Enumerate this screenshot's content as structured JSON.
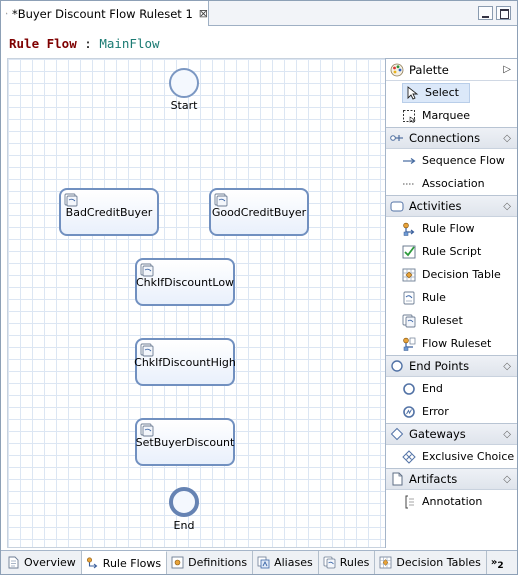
{
  "editor": {
    "tab_title": "*Buyer Discount Flow Ruleset 1",
    "close_glyph": "⊠"
  },
  "flow": {
    "keyword": "Rule Flow",
    "separator": ":",
    "name": "MainFlow"
  },
  "canvas": {
    "start_label": "Start",
    "end_label": "End",
    "nodes": {
      "bad_credit": "BadCreditBuyer",
      "good_credit": "GoodCreditBuyer",
      "chk_low": "ChkIfDiscountLow",
      "chk_high": "ChkIfDiscountHigh",
      "set_discount": "SetBuyerDiscount"
    }
  },
  "palette": {
    "title": "Palette",
    "tools": {
      "select": "Select",
      "marquee": "Marquee"
    },
    "connections": {
      "title": "Connections",
      "sequence_flow": "Sequence Flow",
      "association": "Association"
    },
    "activities": {
      "title": "Activities",
      "rule_flow": "Rule Flow",
      "rule_script": "Rule Script",
      "decision_table": "Decision Table",
      "rule": "Rule",
      "ruleset": "Ruleset",
      "flow_ruleset": "Flow Ruleset"
    },
    "end_points": {
      "title": "End Points",
      "end": "End",
      "error": "Error"
    },
    "gateways": {
      "title": "Gateways",
      "exclusive_choice": "Exclusive Choice"
    },
    "artifacts": {
      "title": "Artifacts",
      "annotation": "Annotation"
    }
  },
  "bottom_tabs": {
    "overview": "Overview",
    "rule_flows": "Rule Flows",
    "definitions": "Definitions",
    "aliases": "Aliases",
    "rules": "Rules",
    "decision_tables": "Decision Tables",
    "more_count": "2"
  },
  "colors": {
    "node_border": "#7190c0",
    "grid": "#dce6f3",
    "keyword": "#7f0000",
    "flow_name": "#1b7b73"
  }
}
